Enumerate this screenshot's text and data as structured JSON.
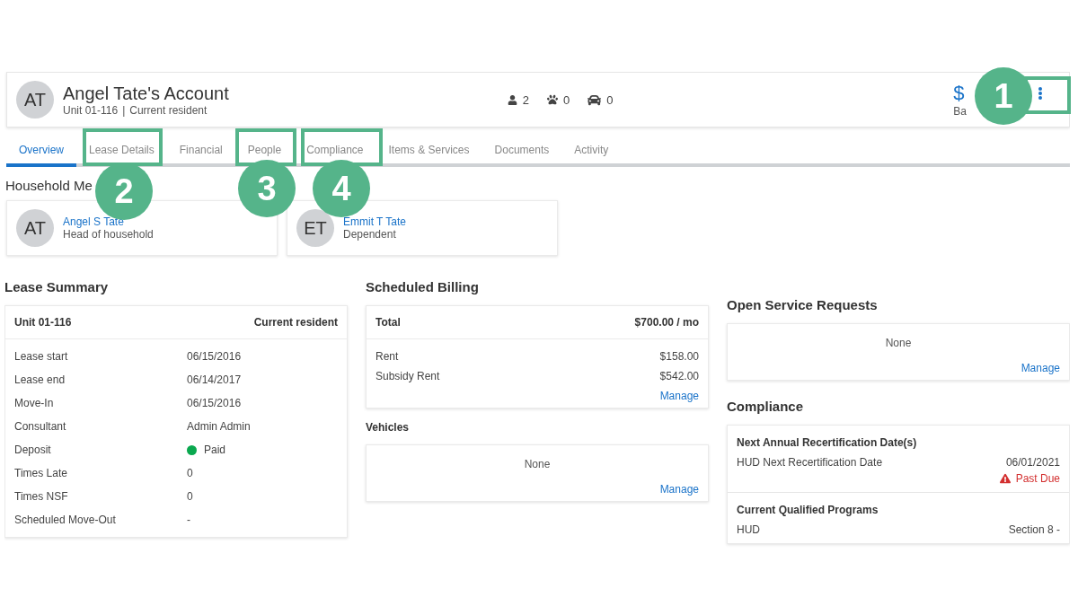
{
  "account": {
    "initials": "AT",
    "name": "Angel Tate's Account",
    "unit": "Unit 01-116",
    "separator": "|",
    "status": "Current resident",
    "counts": [
      {
        "kind": "people",
        "value": "2"
      },
      {
        "kind": "pets",
        "value": "0"
      },
      {
        "kind": "vehicles",
        "value": "0"
      }
    ],
    "balance_amount": "$",
    "balance_label": "Ba"
  },
  "tabs": [
    {
      "label": "Overview",
      "selected": true
    },
    {
      "label": "Lease Details",
      "selected": false
    },
    {
      "label": "Financial",
      "selected": false
    },
    {
      "label": "People",
      "selected": false
    },
    {
      "label": "Compliance",
      "selected": false
    },
    {
      "label": "Items & Services",
      "selected": false
    },
    {
      "label": "Documents",
      "selected": false
    },
    {
      "label": "Activity",
      "selected": false
    }
  ],
  "household": {
    "title": "Household Me",
    "members": [
      {
        "initials": "AT",
        "name": "Angel S Tate",
        "role": "Head of household"
      },
      {
        "initials": "ET",
        "name": "Emmit T Tate",
        "role": "Dependent"
      }
    ]
  },
  "lease_summary": {
    "title": "Lease Summary",
    "header": [
      "Unit 01-116",
      "Current resident"
    ],
    "rows": [
      {
        "kind": "text",
        "label": "Lease start",
        "value": "06/15/2016"
      },
      {
        "kind": "text",
        "label": "Lease end",
        "value": "06/14/2017"
      },
      {
        "kind": "text",
        "label": "Move-In",
        "value": "06/15/2016"
      },
      {
        "kind": "text",
        "label": "Consultant",
        "value": "Admin Admin"
      },
      {
        "kind": "status",
        "label": "Deposit",
        "value": "Paid",
        "color": "#0aa84f"
      },
      {
        "kind": "text",
        "label": "Times Late",
        "value": "0"
      },
      {
        "kind": "text",
        "label": "Times NSF",
        "value": "0"
      },
      {
        "kind": "text",
        "label": "Scheduled Move-Out",
        "value": "-"
      }
    ]
  },
  "billing": {
    "title": "Scheduled Billing",
    "total_label": "Total",
    "total_value": "$700.00 / mo",
    "rows": [
      {
        "label": "Rent",
        "value": "$158.00"
      },
      {
        "label": "Subsidy Rent",
        "value": "$542.00"
      }
    ],
    "link": "Manage"
  },
  "vehicles": {
    "title": "Vehicles",
    "empty": "None",
    "link": "Manage"
  },
  "service_requests": {
    "title": "Open Service Requests",
    "empty": "None",
    "link": "Manage"
  },
  "compliance": {
    "title": "Compliance",
    "sections": [
      {
        "heading": "Next Annual Recertification Date(s)",
        "rows": [
          {
            "label": "HUD Next Recertification Date",
            "value": "06/01/2021",
            "alert": "Past Due"
          }
        ]
      },
      {
        "heading": "Current Qualified Programs",
        "rows": [
          {
            "label": "HUD",
            "value": "Section 8 -"
          }
        ]
      }
    ]
  },
  "callouts": [
    {
      "number": "1"
    },
    {
      "number": "2"
    },
    {
      "number": "3"
    },
    {
      "number": "4"
    }
  ]
}
